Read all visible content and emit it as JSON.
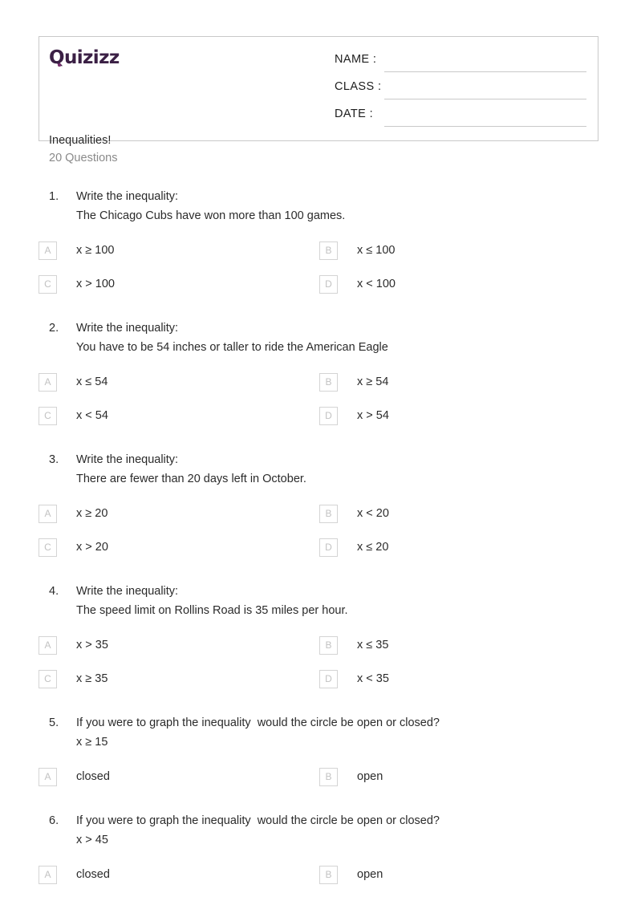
{
  "header": {
    "brand": "Quizizz",
    "quiz_title": "Inequalities!",
    "question_count_label": "20 Questions",
    "fields": [
      {
        "label": "NAME :",
        "value": ""
      },
      {
        "label": "CLASS :",
        "value": ""
      },
      {
        "label": "DATE  :",
        "value": ""
      }
    ]
  },
  "questions": [
    {
      "number": "1.",
      "prompt": "Write the inequality:",
      "detail": "The Chicago Cubs have won more than 100 games.",
      "options": [
        {
          "letter": "A",
          "text": "x ≥ 100"
        },
        {
          "letter": "B",
          "text": "x ≤ 100"
        },
        {
          "letter": "C",
          "text": "x > 100"
        },
        {
          "letter": "D",
          "text": "x < 100"
        }
      ]
    },
    {
      "number": "2.",
      "prompt": "Write the inequality:",
      "detail": "You have to be 54 inches or taller to ride the American Eagle",
      "options": [
        {
          "letter": "A",
          "text": "x ≤ 54"
        },
        {
          "letter": "B",
          "text": "x ≥ 54"
        },
        {
          "letter": "C",
          "text": "x < 54"
        },
        {
          "letter": "D",
          "text": "x > 54"
        }
      ]
    },
    {
      "number": "3.",
      "prompt": "Write the inequality:",
      "detail": "There are fewer than 20 days left in October.",
      "options": [
        {
          "letter": "A",
          "text": "x ≥ 20"
        },
        {
          "letter": "B",
          "text": "x < 20"
        },
        {
          "letter": "C",
          "text": "x > 20"
        },
        {
          "letter": "D",
          "text": "x ≤ 20"
        }
      ]
    },
    {
      "number": "4.",
      "prompt": "Write the inequality:",
      "detail": "The speed limit on Rollins Road is 35 miles per hour.",
      "options": [
        {
          "letter": "A",
          "text": "x > 35"
        },
        {
          "letter": "B",
          "text": "x ≤ 35"
        },
        {
          "letter": "C",
          "text": "x ≥ 35"
        },
        {
          "letter": "D",
          "text": "x < 35"
        }
      ]
    },
    {
      "number": "5.",
      "prompt": "If you were to graph the inequality  would the circle be open or closed?",
      "detail": "x ≥ 15",
      "options": [
        {
          "letter": "A",
          "text": "closed"
        },
        {
          "letter": "B",
          "text": "open"
        }
      ]
    },
    {
      "number": "6.",
      "prompt": "If you were to graph the inequality  would the circle be open or closed?",
      "detail": "x > 45",
      "options": [
        {
          "letter": "A",
          "text": "closed"
        },
        {
          "letter": "B",
          "text": "open"
        }
      ]
    }
  ]
}
